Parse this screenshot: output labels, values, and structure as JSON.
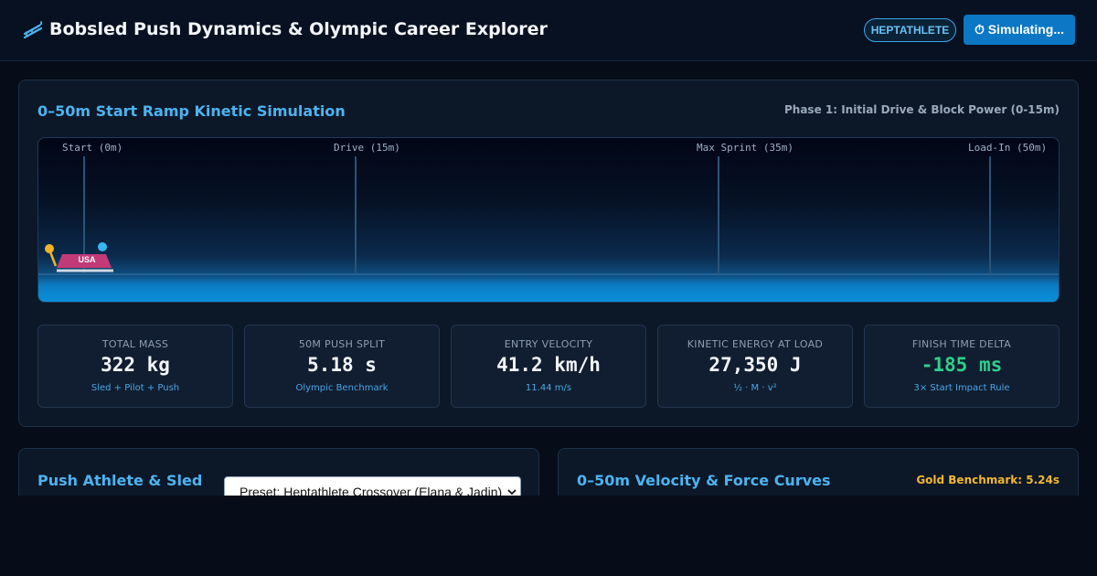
{
  "header": {
    "title": "Bobsled Push Dynamics & Olympic Career Explorer",
    "badge": "HEPTATHLETE",
    "sim_button": "⏱ Simulating...",
    "brand_icon": "bobsled-icon"
  },
  "simulation": {
    "title": "0–50m Start Ramp Kinetic Simulation",
    "phase": "Phase 1: Initial Drive & Block Power (0-15m)",
    "markers": [
      {
        "label": "Start (0m)"
      },
      {
        "label": "Drive (15m)"
      },
      {
        "label": "Max Sprint (35m)"
      },
      {
        "label": "Load-In (50m)"
      }
    ],
    "sled_label": "USA",
    "sled_position_m": 0,
    "colors": {
      "sled": "#c23a78",
      "pusher_1": "#f0b429",
      "pusher_2": "#38b6f0",
      "marker_line": "#2a5478"
    }
  },
  "stats": [
    {
      "label": "TOTAL MASS",
      "value": "322 kg",
      "sub": "Sled + Pilot + Push"
    },
    {
      "label": "50M PUSH SPLIT",
      "value": "5.18 s",
      "sub": "Olympic Benchmark"
    },
    {
      "label": "ENTRY VELOCITY",
      "value": "41.2 km/h",
      "sub": "11.44 m/s"
    },
    {
      "label": "KINETIC ENERGY AT LOAD",
      "value": "27,350 J",
      "sub": "½ · M · v²"
    },
    {
      "label": "FINISH TIME DELTA",
      "value": "-185 ms",
      "sub": "3× Start Impact Rule",
      "status_color": "#2fcf8c"
    }
  ],
  "athlete_panel": {
    "title": "Push Athlete & Sled",
    "preset_selected": "Preset: Heptathlete Crossover (Elana & Jadin)"
  },
  "curves_panel": {
    "title": "0–50m Velocity & Force Curves",
    "benchmark": "Gold Benchmark: 5.24s"
  }
}
